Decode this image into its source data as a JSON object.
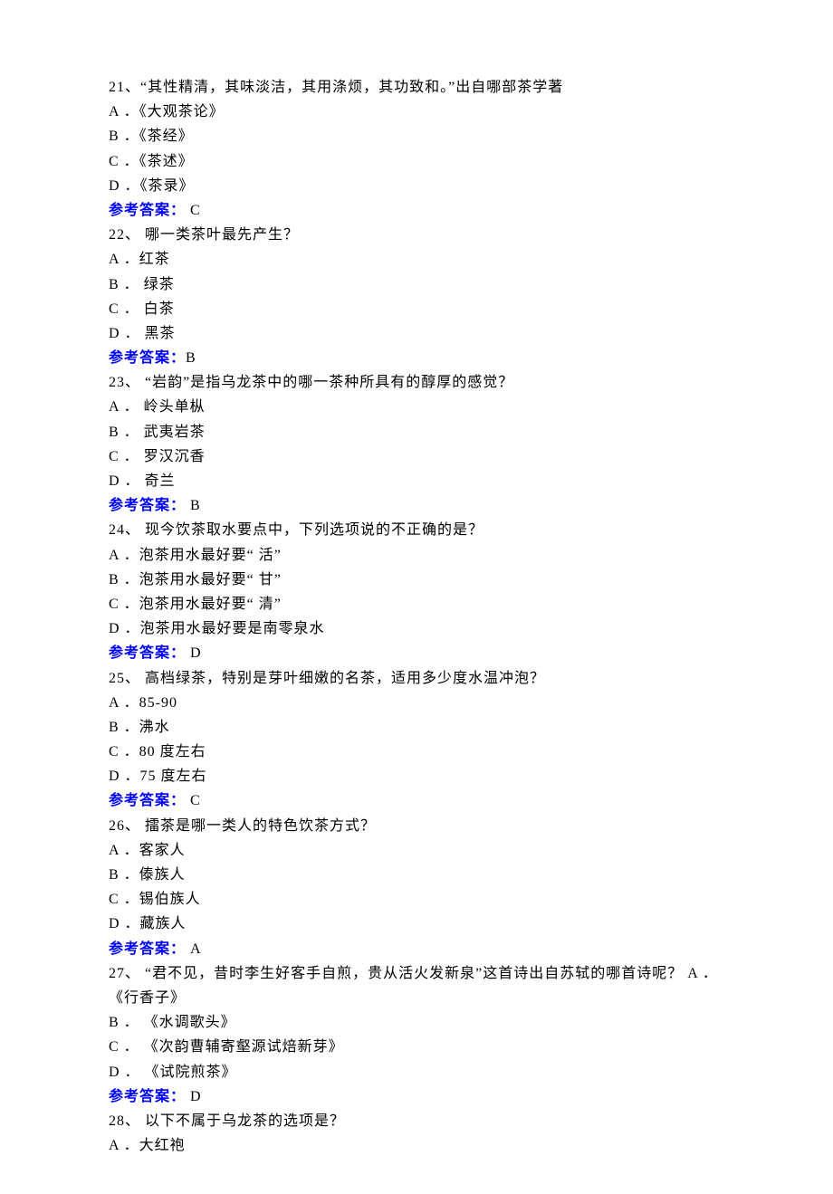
{
  "answer_label": "参考答案：",
  "questions": [
    {
      "num": "21、",
      "text": "“其性精清，其味淡洁，其用涤烦，其功致和。”出自哪部茶学著",
      "options": [
        "A ．《大观茶论》",
        "B ．《茶经》",
        "C ．《茶述》",
        "D ．《茶录》"
      ],
      "answer": " C"
    },
    {
      "num": "22、",
      "text": " 哪一类茶叶最先产生？",
      "options": [
        "A ．红茶",
        "B ． 绿茶",
        "C ． 白茶",
        "D ． 黑茶"
      ],
      "answer": "B"
    },
    {
      "num": "23、",
      "text": " “岩韵”是指乌龙茶中的哪一茶种所具有的醇厚的感觉？",
      "options": [
        "A ． 岭头单枞",
        "B ． 武夷岩茶",
        "C ． 罗汉沉香",
        "D ． 奇兰"
      ],
      "answer": " B"
    },
    {
      "num": "24、",
      "text": " 现今饮茶取水要点中，下列选项说的不正确的是？",
      "options": [
        "A ．泡茶用水最好要“ 活”",
        "B ．泡茶用水最好要“ 甘”",
        "C ．泡茶用水最好要“ 清”",
        "D ．泡茶用水最好要是南零泉水"
      ],
      "answer": " D"
    },
    {
      "num": "25、",
      "text": " 高档绿茶，特别是芽叶细嫩的名茶，适用多少度水温冲泡？",
      "options": [
        "A ．85-90",
        "B ．沸水",
        "C ．80 度左右",
        "D ．75 度左右"
      ],
      "answer": " C"
    },
    {
      "num": "26、",
      "text": " 擂茶是哪一类人的特色饮茶方式？",
      "options": [
        "A ．客家人",
        "B ．傣族人",
        "C ．锡伯族人",
        "D ．藏族人"
      ],
      "answer": " A"
    },
    {
      "num": "27、",
      "text": " “君不见，昔时李生好客手自煎，贵从活火发新泉”这首诗出自苏轼的哪首诗呢？ A ．",
      "options": [
        "《行香子》",
        "B ． 《水调歌头》",
        "C ． 《次韵曹辅寄壑源试焙新芽》",
        "D ． 《试院煎茶》"
      ],
      "answer": " D"
    },
    {
      "num": "28、",
      "text": " 以下不属于乌龙茶的选项是？",
      "options": [
        "A ．大红袍"
      ],
      "answer": null
    }
  ]
}
